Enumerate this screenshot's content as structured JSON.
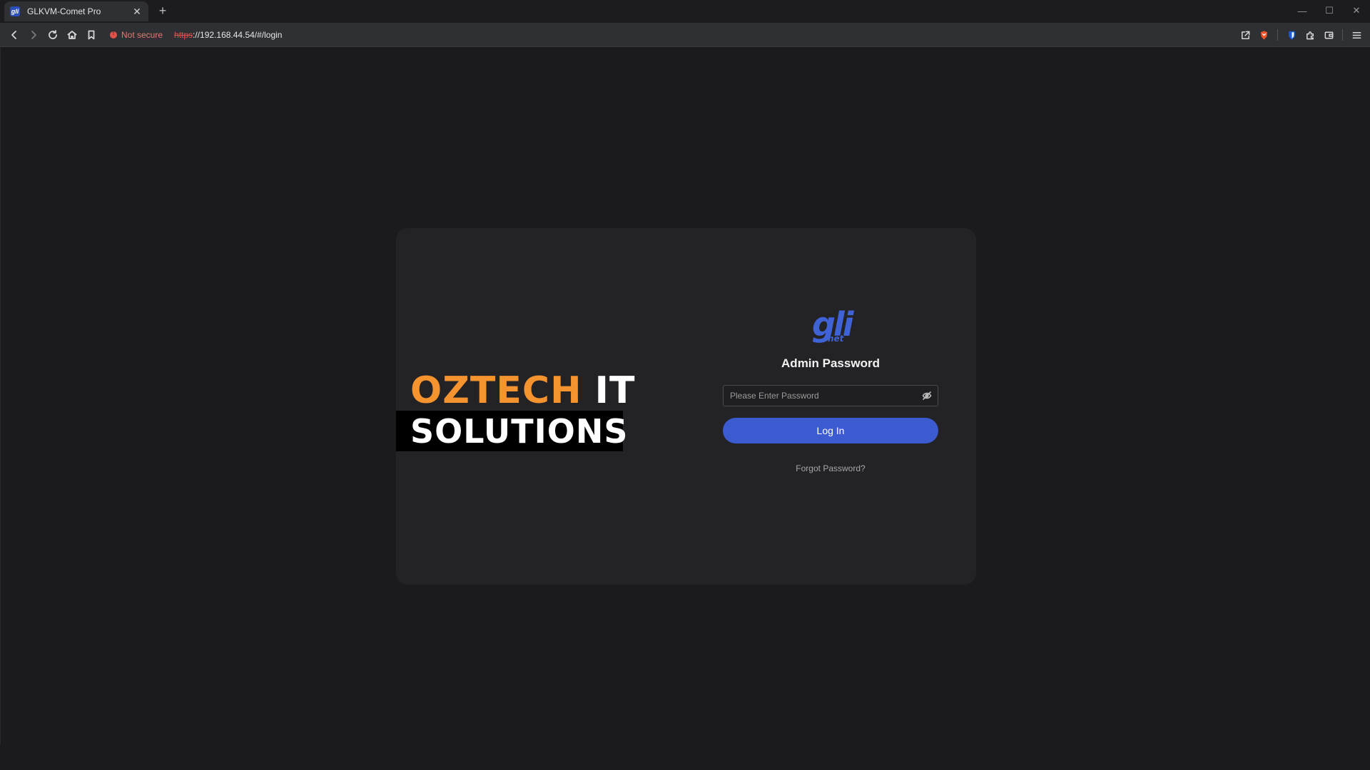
{
  "browser": {
    "tab_title": "GLKVM-Comet Pro",
    "tab_favicon": "gli",
    "tab_close": "✕",
    "new_tab": "+",
    "security_label": "Not secure",
    "url_scheme": "https",
    "url_rest": "://192.168.44.54/#/login",
    "window": {
      "minimize": "—",
      "maximize": "☐",
      "close": "✕"
    },
    "icons": [
      "back-icon",
      "forward-icon",
      "reload-icon",
      "home-icon",
      "bookmark-icon",
      "share-icon",
      "brave-shield-icon",
      "bitwarden-icon",
      "extensions-icon",
      "wallet-icon",
      "menu-icon"
    ]
  },
  "brand": {
    "word1": "OZTECH",
    "word2": "IT",
    "word3": "SOLUTIONS",
    "accent_color": "#f5932e"
  },
  "login": {
    "logo_main": "gli",
    "logo_sub": "net",
    "title": "Admin Password",
    "password_placeholder": "Please Enter Password",
    "password_value": "",
    "submit_label": "Log In",
    "forgot_label": "Forgot Password?",
    "button_color": "#3d5bd0"
  }
}
